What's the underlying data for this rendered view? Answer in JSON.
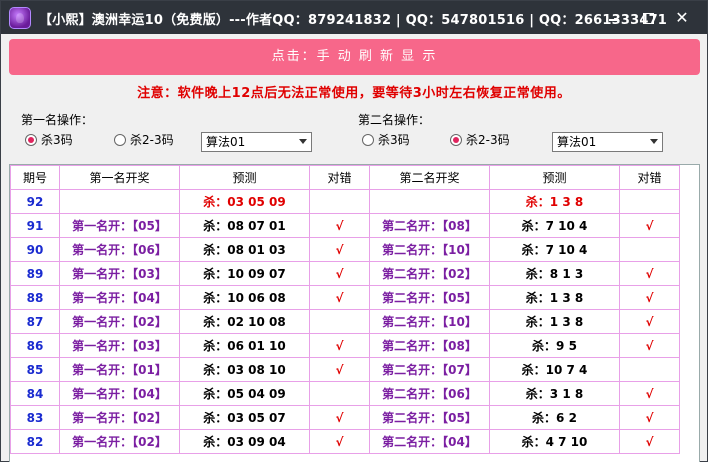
{
  "window": {
    "title": "【小熙】澳洲幸运10（免费版）---作者QQ：879241832 | QQ：547801516 | QQ：2661333471",
    "minimize": "—",
    "maximize": "□",
    "close": "✕"
  },
  "refresh_button": "点击：手 动 刷 新 显 示",
  "notice": "注意：软件晚上12点后无法正常使用，要等待3小时左右恢复正常使用。",
  "op1": {
    "label": "第一名操作：",
    "radio1": "杀3码",
    "radio2": "杀2-3码",
    "selected_radio": 1,
    "algo": "算法01"
  },
  "op2": {
    "label": "第二名操作：",
    "radio1": "杀3码",
    "radio2": "杀2-3码",
    "selected_radio": 2,
    "algo": "算法01"
  },
  "table": {
    "headers": [
      "期号",
      "第一名开奖",
      "预测",
      "对错",
      "第二名开奖",
      "预测",
      "对错"
    ],
    "rows": [
      {
        "issue": "92",
        "kj1": "",
        "yc1": "杀：03 05 09",
        "ok1": "",
        "kj2": "",
        "yc2": "杀：1 3 8",
        "ok2": "",
        "current": true
      },
      {
        "issue": "91",
        "kj1": "第一名开：【05】",
        "yc1": "杀：08 07 01",
        "ok1": "√",
        "kj2": "第二名开：【08】",
        "yc2": "杀：7 10 4",
        "ok2": "√"
      },
      {
        "issue": "90",
        "kj1": "第一名开：【06】",
        "yc1": "杀：08 01 03",
        "ok1": "√",
        "kj2": "第二名开：【10】",
        "yc2": "杀：7 10 4",
        "ok2": ""
      },
      {
        "issue": "89",
        "kj1": "第一名开：【03】",
        "yc1": "杀：10 09 07",
        "ok1": "√",
        "kj2": "第二名开：【02】",
        "yc2": "杀：8 1 3",
        "ok2": "√"
      },
      {
        "issue": "88",
        "kj1": "第一名开：【04】",
        "yc1": "杀：10 06 08",
        "ok1": "√",
        "kj2": "第二名开：【05】",
        "yc2": "杀：1 3 8",
        "ok2": "√"
      },
      {
        "issue": "87",
        "kj1": "第一名开：【02】",
        "yc1": "杀：02 10 08",
        "ok1": "",
        "kj2": "第二名开：【10】",
        "yc2": "杀：1 3 8",
        "ok2": "√"
      },
      {
        "issue": "86",
        "kj1": "第一名开：【03】",
        "yc1": "杀：06 01 10",
        "ok1": "√",
        "kj2": "第二名开：【08】",
        "yc2": "杀：9 5",
        "ok2": "√"
      },
      {
        "issue": "85",
        "kj1": "第一名开：【01】",
        "yc1": "杀：03 08 10",
        "ok1": "√",
        "kj2": "第二名开：【07】",
        "yc2": "杀：10 7 4",
        "ok2": ""
      },
      {
        "issue": "84",
        "kj1": "第一名开：【04】",
        "yc1": "杀：05 04 09",
        "ok1": "",
        "kj2": "第二名开：【06】",
        "yc2": "杀：3 1 8",
        "ok2": "√"
      },
      {
        "issue": "83",
        "kj1": "第一名开：【02】",
        "yc1": "杀：03 05 07",
        "ok1": "√",
        "kj2": "第二名开：【05】",
        "yc2": "杀：6 2",
        "ok2": "√"
      },
      {
        "issue": "82",
        "kj1": "第一名开：【02】",
        "yc1": "杀：03 09 04",
        "ok1": "√",
        "kj2": "第二名开：【04】",
        "yc2": "杀：4 7 10",
        "ok2": "√"
      }
    ]
  },
  "colors": {
    "title_bg": "#2e333a",
    "refresh_bg": "#f7678a",
    "notice": "#e00000",
    "issue": "#1a2bd0",
    "draw": "#7b1fa2",
    "grid_border": "#e8a0e8"
  }
}
